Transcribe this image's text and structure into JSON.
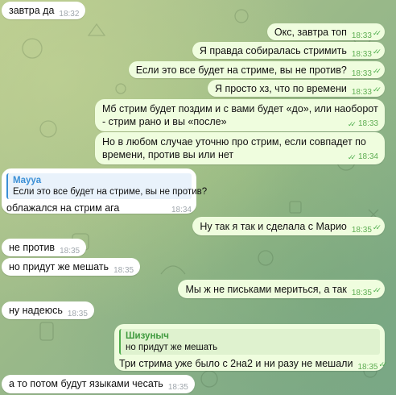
{
  "messages": [
    {
      "text": "завтра да",
      "time": "18:32"
    },
    {
      "text": "Окс, завтра топ",
      "time": "18:33"
    },
    {
      "text": "Я правда собиралась стримить",
      "time": "18:33"
    },
    {
      "text": "Если это все будет на стриме, вы не против?",
      "time": "18:33"
    },
    {
      "text": "Я просто хз, что по времени",
      "time": "18:33"
    },
    {
      "text": "Мб стрим будет поздим и с вами будет «до», или наоборот - стрим рано и вы «после»",
      "time": "18:33"
    },
    {
      "text": "Но в любом случае уточню про стрим, если совпадет по времени, против вы или нет",
      "time": "18:34"
    },
    {
      "reply_name": "Mayya",
      "reply_text": "Если это все будет на стриме, вы не против?",
      "text": "облажался на стрим ага",
      "time": "18:34"
    },
    {
      "text": "Ну так я так и сделала с Марио",
      "time": "18:35"
    },
    {
      "text": "не против",
      "time": "18:35"
    },
    {
      "text": "но придут же мешать",
      "time": "18:35"
    },
    {
      "text": "Мы ж не письками мериться, а так",
      "time": "18:35"
    },
    {
      "text": "ну надеюсь",
      "time": "18:35"
    },
    {
      "reply_name": "Шизуныч",
      "reply_text": "но придут же мешать",
      "text": "Три стрима уже было с 2на2 и ни разу не мешали",
      "time": "18:35"
    },
    {
      "text": "а то потом будут языками чесать",
      "time": "18:35"
    }
  ],
  "colors": {
    "incoming_bubble": "#ffffff",
    "outgoing_bubble": "#effdde",
    "read_check": "#4fae4e",
    "reply_accent_1": "#3a8fd6",
    "reply_accent_2": "#4fae4e"
  },
  "icons": [
    "double-check-icon"
  ]
}
